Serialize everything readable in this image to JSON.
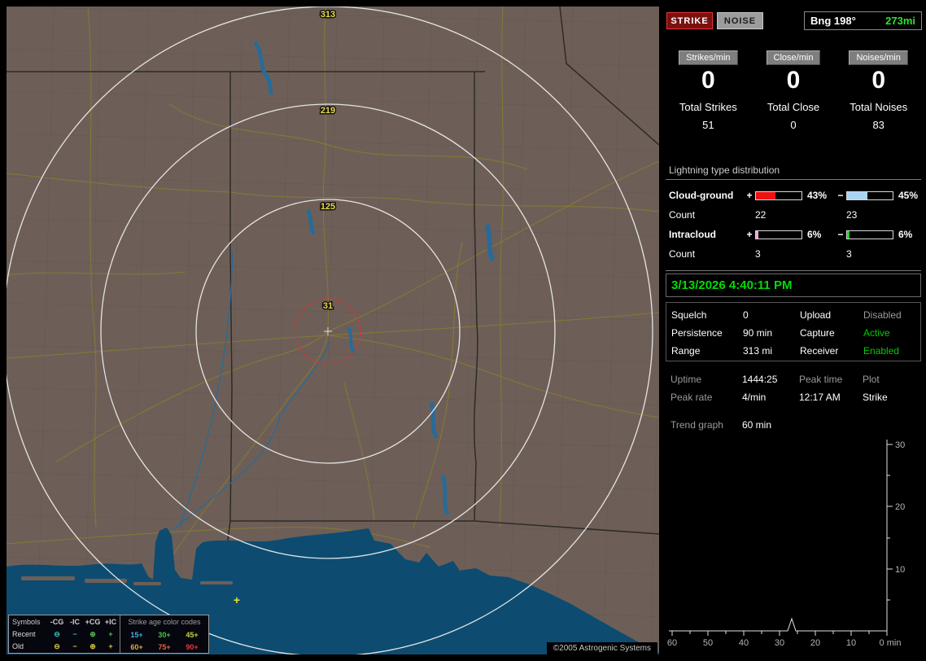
{
  "window": {
    "credit": "©2005 Astrogenic Systems"
  },
  "map": {
    "ring_labels": [
      "313",
      "219",
      "125",
      "31"
    ],
    "strike_marker": "+"
  },
  "indicators": {
    "strike": "STRIKE",
    "noise": "NOISE",
    "bearing": "Bng 198°",
    "distance": "273mi"
  },
  "counters": {
    "items": [
      {
        "label": "Strikes/min",
        "value": "0",
        "total_label": "Total Strikes",
        "total": "51"
      },
      {
        "label": "Close/min",
        "value": "0",
        "total_label": "Total Close",
        "total": "0"
      },
      {
        "label": "Noises/min",
        "value": "0",
        "total_label": "Total Noises",
        "total": "83"
      }
    ]
  },
  "distribution": {
    "header": "Lightning type distribution",
    "plus_sign": "+",
    "minus_sign": "−",
    "rows": [
      {
        "label": "Cloud-ground",
        "plus_fill": 43,
        "plus_color": "#ee1111",
        "plus_pct": "43%",
        "minus_fill": 45,
        "minus_color": "#a9d5f2",
        "minus_pct": "45%",
        "count_label": "Count",
        "plus_count": "22",
        "minus_count": "23"
      },
      {
        "label": "Intracloud",
        "plus_fill": 6,
        "plus_color": "#eeaad8",
        "plus_pct": "6%",
        "minus_fill": 6,
        "minus_color": "#22cc22",
        "minus_pct": "6%",
        "count_label": "Count",
        "plus_count": "3",
        "minus_count": "3"
      }
    ]
  },
  "clock": {
    "datetime": "3/13/2026 4:40:11 PM"
  },
  "status": {
    "rows": [
      {
        "l1": "Squelch",
        "v1": "0",
        "l2": "Upload",
        "v2": "Disabled"
      },
      {
        "l1": "Persistence",
        "v1": "90 min",
        "l2": "Capture",
        "v2": "Active"
      },
      {
        "l1": "Range",
        "v1": "313 mi",
        "l2": "Receiver",
        "v2": "Enabled"
      }
    ]
  },
  "stats": {
    "rows": [
      [
        "Uptime",
        "1444:25",
        "Peak time",
        "Plot"
      ],
      [
        "Peak rate",
        "4/min",
        "12:17 AM",
        "Strike"
      ]
    ],
    "trend_label": "Trend graph",
    "trend_window": "60 min"
  },
  "trend": {
    "y_ticks": [
      "30",
      "20",
      "10"
    ],
    "x_ticks": [
      "60",
      "50",
      "40",
      "30",
      "20",
      "10"
    ],
    "x_end": "0 min",
    "spike_minutes_ago": 27,
    "spike_value": 2
  },
  "legend": {
    "col_headers": [
      "Symbols",
      "-CG",
      "-IC",
      "+CG",
      "+IC"
    ],
    "age_header": "Strike age color codes",
    "rows": [
      {
        "label": "Recent",
        "symbols": [
          "⊖",
          "−",
          "⊕",
          "+"
        ],
        "symbol_colors": [
          "#3fc0c0",
          "#3fc0c0",
          "#4ec44e",
          "#4ec44e"
        ],
        "ages": [
          "15+",
          "30+",
          "45+"
        ],
        "age_colors": [
          "#3fb0e0",
          "#4ec44e",
          "#c8d444"
        ]
      },
      {
        "label": "Old",
        "symbols": [
          "⊖",
          "−",
          "⊕",
          "+"
        ],
        "symbol_colors": [
          "#d8c83a",
          "#d8c83a",
          "#d8c83a",
          "#d8c83a"
        ],
        "ages": [
          "60+",
          "75+",
          "90+"
        ],
        "age_colors": [
          "#e0a83c",
          "#e0683c",
          "#e03c3c"
        ]
      }
    ]
  }
}
